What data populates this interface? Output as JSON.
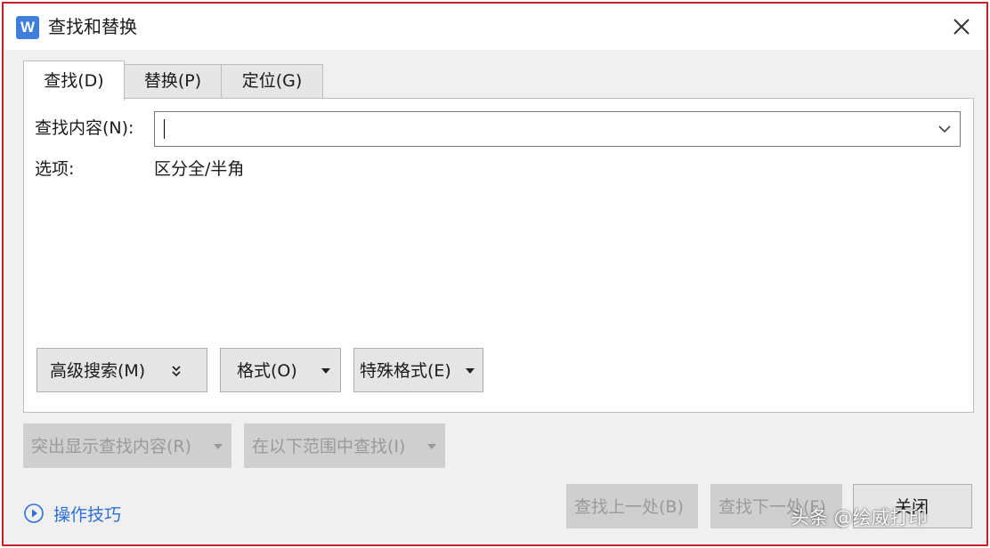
{
  "window": {
    "title": "查找和替换",
    "app_icon_letter": "W",
    "close_icon": "close-icon"
  },
  "tabs": [
    {
      "label": "查找(D)",
      "active": true
    },
    {
      "label": "替换(P)",
      "active": false
    },
    {
      "label": "定位(G)",
      "active": false
    }
  ],
  "find": {
    "label": "查找内容(N):",
    "value": "",
    "options_label": "选项:",
    "options_value": "区分全/半角"
  },
  "panel_buttons": {
    "advanced": "高级搜索(M)",
    "format": "格式(O)",
    "special": "特殊格式(E)"
  },
  "disabled_buttons": {
    "highlight": "突出显示查找内容(R)",
    "find_in": "在以下范围中查找(I)"
  },
  "footer": {
    "tips": "操作技巧",
    "find_prev": "查找上一处(B)",
    "find_next": "查找下一处(F)",
    "close": "关闭"
  },
  "watermark": "头条 @绘威打印",
  "colors": {
    "app_icon": "#3f7fdc",
    "link": "#2b6fd6",
    "dialog_border": "#c8202a"
  }
}
